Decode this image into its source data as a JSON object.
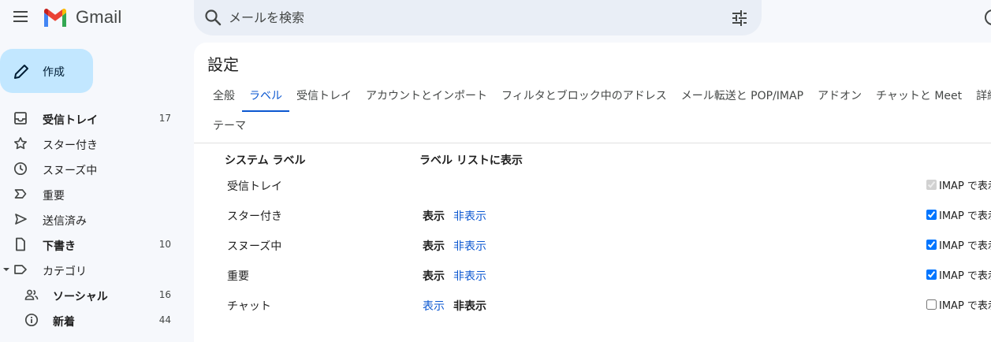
{
  "app": {
    "name": "Gmail"
  },
  "search": {
    "placeholder": "メールを検索"
  },
  "colors": {
    "accent": "#0b57d0",
    "compose_bg": "#c2e7ff",
    "background": "#f6f8fc"
  },
  "sidebar": {
    "compose_label": "作成",
    "items": [
      {
        "label": "受信トレイ",
        "count": "17",
        "icon": "inbox-icon",
        "bold": true
      },
      {
        "label": "スター付き",
        "count": "",
        "icon": "star-icon",
        "bold": false
      },
      {
        "label": "スヌーズ中",
        "count": "",
        "icon": "clock-icon",
        "bold": false
      },
      {
        "label": "重要",
        "count": "",
        "icon": "important-icon",
        "bold": false
      },
      {
        "label": "送信済み",
        "count": "",
        "icon": "send-icon",
        "bold": false
      },
      {
        "label": "下書き",
        "count": "10",
        "icon": "draft-icon",
        "bold": true
      },
      {
        "label": "カテゴリ",
        "count": "",
        "icon": "label-icon",
        "bold": false
      },
      {
        "label": "ソーシャル",
        "count": "16",
        "icon": "people-icon",
        "bold": true
      },
      {
        "label": "新着",
        "count": "44",
        "icon": "info-icon",
        "bold": true
      }
    ]
  },
  "settings": {
    "title": "設定",
    "tabs": [
      {
        "label": "全般",
        "active": false
      },
      {
        "label": "ラベル",
        "active": true
      },
      {
        "label": "受信トレイ",
        "active": false
      },
      {
        "label": "アカウントとインポート",
        "active": false
      },
      {
        "label": "フィルタとブロック中のアドレス",
        "active": false
      },
      {
        "label": "メール転送と POP/IMAP",
        "active": false
      },
      {
        "label": "アドオン",
        "active": false
      },
      {
        "label": "チャットと Meet",
        "active": false
      },
      {
        "label": "詳細",
        "active": false
      }
    ],
    "tab_second_row": "テーマ",
    "columns": {
      "system_labels": "システム ラベル",
      "show_in_list": "ラベル リストに表示"
    },
    "show_text": "表示",
    "hide_text": "非表示",
    "imap_text": "IMAP で表示",
    "rows": [
      {
        "name": "受信トレイ",
        "has_toggle": false,
        "selected": "",
        "imap_checked": true,
        "imap_disabled": true
      },
      {
        "name": "スター付き",
        "has_toggle": true,
        "selected": "show",
        "imap_checked": true,
        "imap_disabled": false
      },
      {
        "name": "スヌーズ中",
        "has_toggle": true,
        "selected": "show",
        "imap_checked": true,
        "imap_disabled": false
      },
      {
        "name": "重要",
        "has_toggle": true,
        "selected": "show",
        "imap_checked": true,
        "imap_disabled": false
      },
      {
        "name": "チャット",
        "has_toggle": true,
        "selected": "hide",
        "imap_checked": false,
        "imap_disabled": false
      }
    ]
  }
}
